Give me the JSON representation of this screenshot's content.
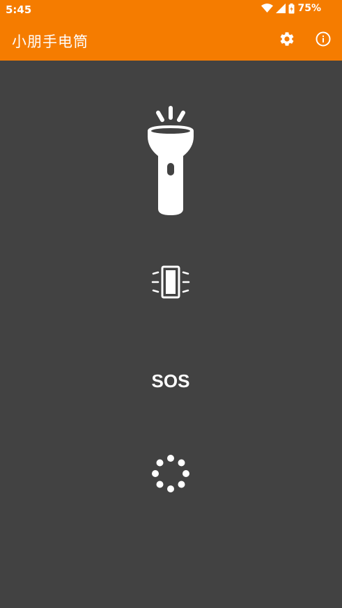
{
  "status_bar": {
    "time": "5:45",
    "battery": "75%",
    "icons": [
      "wifi-icon",
      "signal-icon",
      "battery-icon"
    ]
  },
  "app_bar": {
    "title": "小朋手电筒",
    "actions": [
      "gear-icon",
      "info-icon"
    ]
  },
  "modes": {
    "flashlight_icon": "flashlight-icon",
    "vibrate_icon": "vibrate-icon",
    "sos_label": "SOS",
    "strobe_icon": "loading-dots-icon"
  },
  "colors": {
    "accent": "#f57c00",
    "background": "#424242",
    "foreground": "#ffffff"
  }
}
